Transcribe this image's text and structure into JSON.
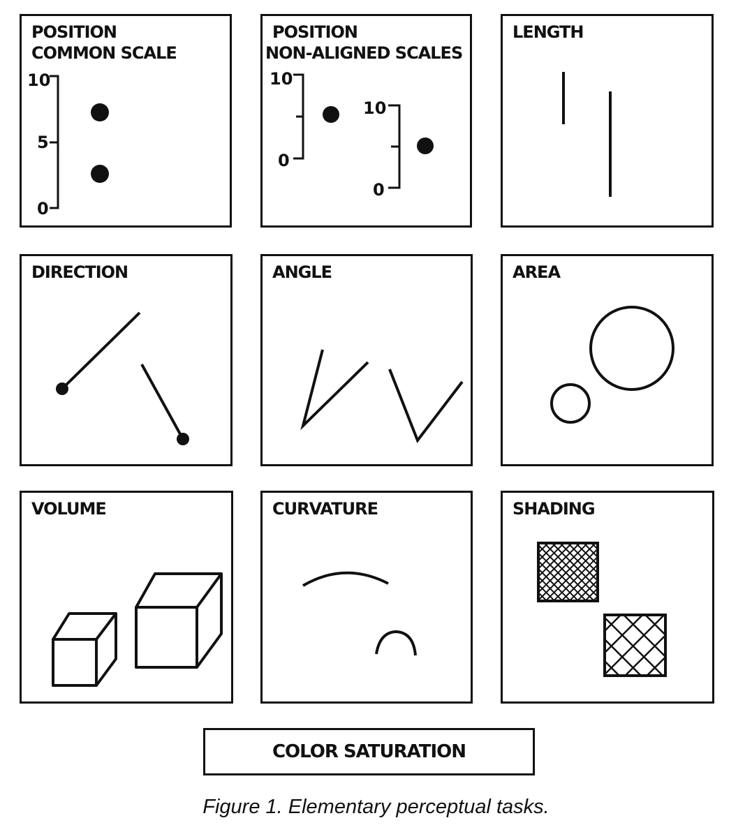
{
  "panels": {
    "position_common": {
      "title_line1": "POSITION",
      "title_line2": "COMMON SCALE",
      "ticks": {
        "top": "10",
        "mid": "5",
        "bottom": "0"
      }
    },
    "position_nonaligned": {
      "title_line1": "POSITION",
      "title_line2": "NON-ALIGNED SCALES",
      "scale1": {
        "top": "10",
        "bottom": "0"
      },
      "scale2": {
        "top": "10",
        "bottom": "0"
      }
    },
    "length": {
      "title": "LENGTH"
    },
    "direction": {
      "title": "DIRECTION"
    },
    "angle": {
      "title": "ANGLE"
    },
    "area": {
      "title": "AREA"
    },
    "volume": {
      "title": "VOLUME"
    },
    "curvature": {
      "title": "CURVATURE"
    },
    "shading": {
      "title": "SHADING"
    }
  },
  "color_saturation": {
    "label": "COLOR SATURATION"
  },
  "caption": "Figure 1. Elementary perceptual tasks."
}
